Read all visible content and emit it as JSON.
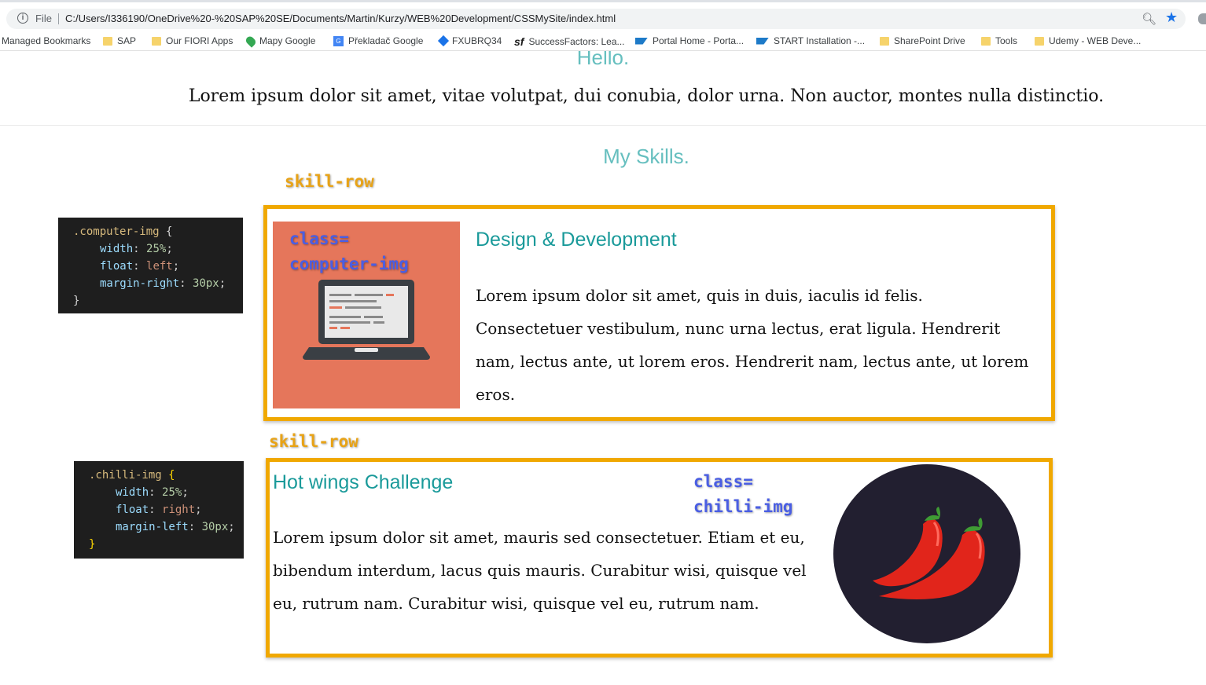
{
  "browser": {
    "file_label": "File",
    "url": "C:/Users/I336190/OneDrive%20-%20SAP%20SE/Documents/Martin/Kurzy/WEB%20Development/CSSMySite/index.html",
    "accent": "#1a73e8"
  },
  "bookmarks": [
    {
      "label": "Managed Bookmarks",
      "icon": "none"
    },
    {
      "label": "SAP",
      "icon": "folder-icon"
    },
    {
      "label": "Our FIORI Apps",
      "icon": "folder-icon"
    },
    {
      "label": "Mapy Google",
      "icon": "map-pin-icon"
    },
    {
      "label": "Překladač Google",
      "icon": "translate-icon"
    },
    {
      "label": "FXUBRQ34",
      "icon": "diamond-icon"
    },
    {
      "label": "SuccessFactors: Lea...",
      "icon": "sf-icon"
    },
    {
      "label": "Portal Home - Porta...",
      "icon": "sap-icon"
    },
    {
      "label": "START Installation -...",
      "icon": "sap-icon"
    },
    {
      "label": "SharePoint Drive",
      "icon": "folder-icon"
    },
    {
      "label": "Tools",
      "icon": "folder-icon"
    },
    {
      "label": "Udemy - WEB Deve...",
      "icon": "folder-icon"
    }
  ],
  "page": {
    "hello": "Hello.",
    "intro": "Lorem ipsum dolor sit amet, vitae volutpat, dui conubia, dolor urna. Non auctor, montes nulla distinctio.",
    "skills_title": "My Skills.",
    "heading_color": "#66bfbf",
    "row_border_color": "#f0a800"
  },
  "annotations": {
    "skill_row_1": "skill-row",
    "skill_row_2": "skill-row",
    "class_computer_1": "class=",
    "class_computer_2": "computer-img",
    "class_chilli_1": "class=",
    "class_chilli_2": "chilli-img"
  },
  "code1": {
    "selector": ".computer-img",
    "open": " {",
    "p1": "width",
    "v1": "25%",
    "p2": "float",
    "v2": "left",
    "p3": "margin-right",
    "v3": "30px",
    "close": "}"
  },
  "code2": {
    "selector": ".chilli-img",
    "open": " {",
    "p1": "width",
    "v1": "25%",
    "p2": "float",
    "v2": "right",
    "p3": "margin-left",
    "v3": "30px",
    "close": "}"
  },
  "skills": [
    {
      "title": "Design & Development",
      "text": "Lorem ipsum dolor sit amet, quis in duis, iaculis id felis. Consectetuer vestibulum, nunc urna lectus, erat ligula. Hendrerit nam, lectus ante, ut lorem eros. Hendrerit nam, lectus ante, ut lorem eros.",
      "image": "laptop-icon"
    },
    {
      "title": "Hot wings Challenge",
      "text": "Lorem ipsum dolor sit amet, mauris sed consectetuer. Etiam et eu, bibendum interdum, lacus quis mauris. Curabitur wisi, quisque vel eu, rutrum nam. Curabitur wisi, quisque vel eu, rutrum nam.",
      "image": "chilli-icon"
    }
  ]
}
